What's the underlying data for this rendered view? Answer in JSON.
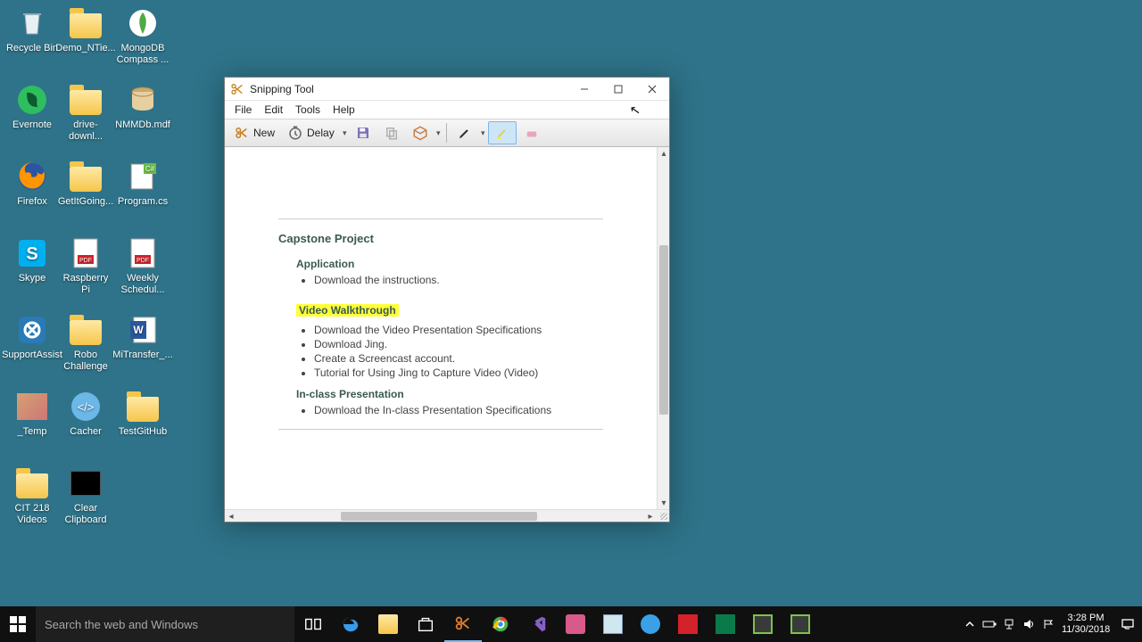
{
  "desktop_icons": [
    {
      "label": "Recycle Bin",
      "row": 0,
      "col": 0,
      "kind": "bin"
    },
    {
      "label": "Demo_NTie...",
      "row": 0,
      "col": 1,
      "kind": "folder"
    },
    {
      "label": "MongoDB Compass ...",
      "row": 0,
      "col": 2,
      "kind": "mongo"
    },
    {
      "label": "Evernote",
      "row": 1,
      "col": 0,
      "kind": "evernote"
    },
    {
      "label": "drive-downl...",
      "row": 1,
      "col": 1,
      "kind": "folder"
    },
    {
      "label": "NMMDb.mdf",
      "row": 1,
      "col": 2,
      "kind": "db"
    },
    {
      "label": "Firefox",
      "row": 2,
      "col": 0,
      "kind": "firefox"
    },
    {
      "label": "GetItGoing...",
      "row": 2,
      "col": 1,
      "kind": "folder"
    },
    {
      "label": "Program.cs",
      "row": 2,
      "col": 2,
      "kind": "cs"
    },
    {
      "label": "Skype",
      "row": 3,
      "col": 0,
      "kind": "skype"
    },
    {
      "label": "Raspberry Pi",
      "row": 3,
      "col": 1,
      "kind": "pdf"
    },
    {
      "label": "Weekly Schedul...",
      "row": 3,
      "col": 2,
      "kind": "pdf"
    },
    {
      "label": "SupportAssist",
      "row": 4,
      "col": 0,
      "kind": "support"
    },
    {
      "label": "Robo Challenge",
      "row": 4,
      "col": 1,
      "kind": "folder"
    },
    {
      "label": "MiTransfer_...",
      "row": 4,
      "col": 2,
      "kind": "word"
    },
    {
      "label": "_Temp",
      "row": 5,
      "col": 0,
      "kind": "img"
    },
    {
      "label": "Cacher",
      "row": 5,
      "col": 1,
      "kind": "cacher"
    },
    {
      "label": "TestGitHub",
      "row": 5,
      "col": 2,
      "kind": "folder"
    },
    {
      "label": "CIT 218 Videos",
      "row": 6,
      "col": 0,
      "kind": "folder"
    },
    {
      "label": "Clear Clipboard",
      "row": 6,
      "col": 1,
      "kind": "bat"
    }
  ],
  "window": {
    "title": "Snipping Tool",
    "menu": [
      "File",
      "Edit",
      "Tools",
      "Help"
    ],
    "toolbar": {
      "new": "New",
      "delay": "Delay"
    }
  },
  "document": {
    "title": "Capstone Project",
    "sections": [
      {
        "heading": "Application",
        "hl": false,
        "items": [
          "Download the instructions."
        ]
      },
      {
        "heading": "Video Walkthrough",
        "hl": true,
        "items": [
          "Download the Video Presentation Specifications",
          "Download Jing.",
          "Create a Screencast account.",
          "Tutorial for Using Jing to Capture Video (Video)"
        ]
      },
      {
        "heading": "In-class Presentation",
        "hl": false,
        "items": [
          "Download the In-class Presentation Specifications"
        ]
      }
    ]
  },
  "taskbar": {
    "search_placeholder": "Search the web and Windows",
    "time": "3:28 PM",
    "date": "11/30/2018"
  }
}
